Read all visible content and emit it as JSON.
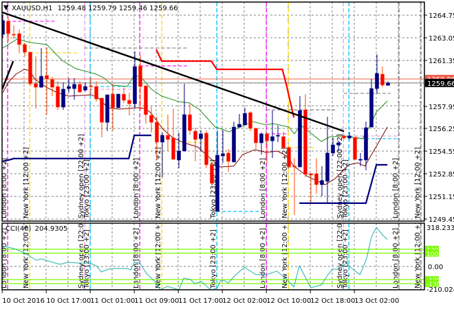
{
  "header": {
    "menu_icon": "triangle-down-icon",
    "symbol": "XAUUSD,H1",
    "ohlc": "1259.48 1259.79 1259.46 1259.66"
  },
  "cci_header": {
    "name": "CCI(40)",
    "value": "204.9305"
  },
  "colors": {
    "bull": "#000080",
    "bear": "#ff0000",
    "wick_bear": "#ff4500",
    "wick_bull": "#000080",
    "ma_fast": "#228b22",
    "ma_slow": "#800000",
    "trend": "#000000",
    "step_red": "#ff0000",
    "step_navy": "#000080",
    "cci": "#20b2aa",
    "cci_level": "#7cfc00",
    "grid": "#808080",
    "bid_line": "#f0604a",
    "last_line": "#808080"
  },
  "chart_data": {
    "type": "candlestick",
    "symbol": "XAUUSD",
    "timeframe": "H1",
    "ylim": [
      1249.45,
      1264.75
    ],
    "price_ticks": [
      "1264.75",
      "1263.05",
      "1261.35",
      "1257.95",
      "1256.25",
      "1254.55",
      "1252.85",
      "1251.15",
      "1249.45"
    ],
    "current_price": "1259.66",
    "bid_price": "1259.96",
    "time_ticks": [
      {
        "bar": -0.1,
        "label": "10 Oct 2016"
      },
      {
        "bar": 7.9,
        "label": "10 Oct 17:00"
      },
      {
        "bar": 15.9,
        "label": "11 Oct 01:00"
      },
      {
        "bar": 23.9,
        "label": "11 Oct 09:00"
      },
      {
        "bar": 31.9,
        "label": "11 Oct 17:00"
      },
      {
        "bar": 39.9,
        "label": "12 Oct 02:00"
      },
      {
        "bar": 47.9,
        "label": "12 Oct 10:00"
      },
      {
        "bar": 55.9,
        "label": "12 Oct 18:00"
      },
      {
        "bar": 63.9,
        "label": "13 Oct 02:00"
      }
    ],
    "candles_ohlc": [
      [
        1263.31,
        1264.75,
        1263.05,
        1264.34
      ],
      [
        1264.29,
        1264.6,
        1262.79,
        1263.36
      ],
      [
        1263.31,
        1263.98,
        1262.95,
        1263.3
      ],
      [
        1263.36,
        1263.67,
        1261.87,
        1262.54
      ],
      [
        1262.54,
        1262.69,
        1261.66,
        1261.97
      ],
      [
        1261.97,
        1261.97,
        1259.44,
        1259.6
      ],
      [
        1259.6,
        1261.66,
        1257.74,
        1259.34
      ],
      [
        1259.34,
        1262.28,
        1259.3,
        1260.16
      ],
      [
        1260.22,
        1262.33,
        1257.28,
        1259.96
      ],
      [
        1259.91,
        1260.11,
        1258.67,
        1259.34
      ],
      [
        1259.39,
        1259.8,
        1257.64,
        1257.85
      ],
      [
        1257.85,
        1259.7,
        1257.64,
        1259.19
      ],
      [
        1259.24,
        1260.01,
        1258.93,
        1259.39
      ],
      [
        1259.24,
        1260.01,
        1258.41,
        1259.55
      ],
      [
        1259.55,
        1259.8,
        1258.93,
        1258.98
      ],
      [
        1259.13,
        1259.7,
        1259.03,
        1259.39
      ],
      [
        1259.44,
        1260.06,
        1258.82,
        1259.42
      ],
      [
        1259.39,
        1259.8,
        1258.26,
        1258.46
      ],
      [
        1258.52,
        1258.52,
        1255.58,
        1256.71
      ],
      [
        1256.71,
        1258.77,
        1256.04,
        1258.77
      ],
      [
        1258.82,
        1259.6,
        1256.09,
        1257.8
      ],
      [
        1257.8,
        1258.85,
        1257.78,
        1258.82
      ],
      [
        1258.82,
        1259.29,
        1258.16,
        1258.36
      ],
      [
        1258.36,
        1258.93,
        1257.23,
        1258.1
      ],
      [
        1258.1,
        1262.02,
        1257.74,
        1260.89
      ],
      [
        1260.94,
        1261.76,
        1257.64,
        1259.39
      ],
      [
        1259.44,
        1259.44,
        1256.61,
        1257.28
      ],
      [
        1257.23,
        1257.9,
        1255.94,
        1256.71
      ],
      [
        1256.71,
        1257.12,
        1253.88,
        1255.22
      ],
      [
        1255.22,
        1255.94,
        1252.59,
        1255.73
      ],
      [
        1255.73,
        1257.28,
        1254.55,
        1255.42
      ],
      [
        1255.53,
        1257.74,
        1253.9,
        1253.93
      ],
      [
        1253.88,
        1255.94,
        1253.26,
        1254.55
      ],
      [
        1254.55,
        1259.6,
        1254.53,
        1257.28
      ],
      [
        1257.28,
        1258.05,
        1255.78,
        1256.09
      ],
      [
        1256.04,
        1256.3,
        1253.78,
        1255.42
      ],
      [
        1255.48,
        1256.09,
        1254.55,
        1255.84
      ],
      [
        1255.89,
        1256.09,
        1253.26,
        1253.52
      ],
      [
        1253.52,
        1253.78,
        1251.97,
        1252.13
      ],
      [
        1250.02,
        1256.09,
        1250.0,
        1254.24
      ],
      [
        1254.19,
        1256.09,
        1253.67,
        1254.35
      ],
      [
        1254.4,
        1254.7,
        1253.0,
        1253.78
      ],
      [
        1253.73,
        1256.76,
        1253.7,
        1256.35
      ],
      [
        1256.35,
        1257.33,
        1256.33,
        1256.56
      ],
      [
        1256.51,
        1257.8,
        1256.49,
        1257.38
      ],
      [
        1257.43,
        1257.54,
        1256.04,
        1256.25
      ],
      [
        1256.25,
        1256.3,
        1254.7,
        1255.17
      ],
      [
        1255.17,
        1255.94,
        1254.29,
        1255.84
      ],
      [
        1255.84,
        1255.94,
        1253.62,
        1255.32
      ],
      [
        1255.32,
        1257.59,
        1254.03,
        1255.63
      ],
      [
        1255.68,
        1256.46,
        1255.22,
        1255.73
      ],
      [
        1255.63,
        1255.99,
        1254.7,
        1254.81
      ],
      [
        1254.81,
        1254.91,
        1253.26,
        1253.36
      ],
      [
        1253.42,
        1254.03,
        1249.76,
        1253.36
      ],
      [
        1253.36,
        1258.67,
        1253.34,
        1257.59
      ],
      [
        1257.64,
        1258.82,
        1252.59,
        1252.8
      ],
      [
        1252.85,
        1252.9,
        1250.69,
        1252.75
      ],
      [
        1252.85,
        1254.03,
        1251.36,
        1252.03
      ],
      [
        1252.03,
        1253.42,
        1251.15,
        1252.34
      ],
      [
        1252.28,
        1257.12,
        1250.69,
        1254.4
      ],
      [
        1254.4,
        1255.58,
        1254.19,
        1255.01
      ],
      [
        1255.01,
        1255.32,
        1254.55,
        1255.17
      ],
      [
        1255.68,
        1255.78,
        1255.42,
        1255.53
      ],
      [
        1255.53,
        1255.99,
        1255.42,
        1255.68
      ],
      [
        1255.58,
        1255.6,
        1253.88,
        1253.93
      ],
      [
        1253.88,
        1254.4,
        1253.42,
        1253.93
      ],
      [
        1253.88,
        1256.76,
        1253.11,
        1256.3
      ],
      [
        1256.35,
        1259.96,
        1256.33,
        1259.24
      ],
      [
        1259.24,
        1261.81,
        1258.88,
        1260.37
      ],
      [
        1260.32,
        1260.89,
        1259.34,
        1259.5
      ],
      [
        1259.48,
        1259.79,
        1259.46,
        1259.66
      ]
    ],
    "ma_fast": [
      [
        0,
        1262.28
      ],
      [
        2.6,
        1262.95
      ],
      [
        5.1,
        1262.69
      ],
      [
        8,
        1262.54
      ],
      [
        10.8,
        1261.35
      ],
      [
        13.3,
        1260.73
      ],
      [
        17,
        1260.32
      ],
      [
        18.3,
        1260.06
      ],
      [
        19.9,
        1259.5
      ],
      [
        22.6,
        1259.39
      ],
      [
        23.9,
        1260.22
      ],
      [
        25.1,
        1260.11
      ],
      [
        27,
        1259.19
      ],
      [
        28.9,
        1258.67
      ],
      [
        32,
        1258.26
      ],
      [
        33.9,
        1258.16
      ],
      [
        35.8,
        1257.64
      ],
      [
        38.6,
        1256.35
      ],
      [
        39.5,
        1256.25
      ],
      [
        41.1,
        1255.99
      ],
      [
        45.4,
        1256.76
      ],
      [
        47.9,
        1256.51
      ],
      [
        49.1,
        1256.61
      ],
      [
        52,
        1256.35
      ],
      [
        53,
        1255.84
      ],
      [
        54.1,
        1256.51
      ],
      [
        57.9,
        1255.27
      ],
      [
        59.5,
        1255.63
      ],
      [
        62,
        1255.68
      ],
      [
        65.4,
        1255.48
      ],
      [
        66.6,
        1256.35
      ],
      [
        67.9,
        1257.48
      ],
      [
        69.9,
        1258.31
      ]
    ],
    "ma_slow": [
      [
        0,
        1258.93
      ],
      [
        1,
        1259.7
      ],
      [
        2.4,
        1260.32
      ],
      [
        3.9,
        1260.68
      ],
      [
        4.9,
        1260.58
      ],
      [
        5.8,
        1259.96
      ],
      [
        7.9,
        1259.34
      ],
      [
        9.9,
        1258.93
      ],
      [
        12,
        1258.67
      ],
      [
        16.1,
        1258.77
      ],
      [
        17.4,
        1258.52
      ],
      [
        19.1,
        1257.8
      ],
      [
        21.1,
        1257.69
      ],
      [
        24.5,
        1257.8
      ],
      [
        26,
        1257.74
      ],
      [
        27,
        1257.38
      ],
      [
        29.1,
        1256.2
      ],
      [
        30.8,
        1255.58
      ],
      [
        32.9,
        1255.17
      ],
      [
        35.4,
        1254.86
      ],
      [
        39.5,
        1253.36
      ],
      [
        42,
        1253.42
      ],
      [
        43.6,
        1254.29
      ],
      [
        45.8,
        1254.65
      ],
      [
        47.9,
        1254.45
      ],
      [
        49.9,
        1254.55
      ],
      [
        51.6,
        1254.19
      ],
      [
        52.9,
        1253.42
      ],
      [
        55.4,
        1252.64
      ],
      [
        58.6,
        1252.03
      ],
      [
        60.4,
        1252.49
      ],
      [
        62.9,
        1253.52
      ],
      [
        64.5,
        1253.67
      ],
      [
        65.8,
        1253.42
      ],
      [
        67.9,
        1254.91
      ],
      [
        69.9,
        1256.35
      ]
    ],
    "trendlines": [
      {
        "color": "trend",
        "points": [
          [
            -0.1,
            1264.96
          ],
          [
            62,
            1256.04
          ]
        ]
      },
      {
        "color": "trend",
        "points": [
          [
            -0.1,
            1259.19
          ],
          [
            1.9,
            1261.3
          ]
        ]
      }
    ],
    "step_red": [
      [
        27.9,
        1262.17
      ],
      [
        28.9,
        1261.3
      ],
      [
        37.9,
        1261.3
      ],
      [
        38.9,
        1260.68
      ],
      [
        50.8,
        1260.68
      ],
      [
        51.5,
        1259.6
      ],
      [
        52.9,
        1257.07
      ]
    ],
    "step_navy_1": [
      [
        -0.1,
        1253.78
      ],
      [
        1.1,
        1253.88
      ],
      [
        2,
        1253.99
      ],
      [
        22.9,
        1253.99
      ],
      [
        23.9,
        1255.73
      ],
      [
        27,
        1255.73
      ]
    ],
    "step_navy_2": [
      [
        53.9,
        1250.64
      ],
      [
        66,
        1250.64
      ],
      [
        67.9,
        1253.52
      ],
      [
        69.9,
        1253.52
      ]
    ],
    "levels": [
      {
        "price": 1264.29,
        "from": 0.8,
        "to": 9.5,
        "color": "#ff00ff"
      },
      {
        "price": 1261.92,
        "from": 4.9,
        "to": 13.5,
        "color": "#ffd700"
      },
      {
        "price": 1262.28,
        "from": 14.8,
        "to": 33.6,
        "color": "#808080"
      },
      {
        "price": 1260.94,
        "from": 24.9,
        "to": 33.5,
        "color": "#ff00ff"
      },
      {
        "price": 1259.39,
        "from": 15.8,
        "to": 23.6,
        "color": "#00bfff"
      },
      {
        "price": 1259.19,
        "from": 15.8,
        "to": 23.6,
        "color": "#dda0dd"
      },
      {
        "price": 1255.22,
        "from": 31.6,
        "to": 37.4,
        "color": "#ffd700"
      },
      {
        "price": 1255.84,
        "from": 47.9,
        "to": 51.6,
        "color": "#ff00ff"
      },
      {
        "price": 1254.81,
        "from": 52,
        "to": 56.6,
        "color": "#ffd700"
      },
      {
        "price": 1255.68,
        "from": 62,
        "to": 71.6,
        "color": "#dda0dd"
      },
      {
        "price": 1255.48,
        "from": 64,
        "to": 71.6,
        "color": "#00bfff"
      },
      {
        "price": 1250.02,
        "from": 38.9,
        "to": 46.6,
        "color": "#00bfff"
      },
      {
        "price": 1258.88,
        "from": 62,
        "to": 70.5,
        "color": "#808080"
      },
      {
        "price": 1257.64,
        "from": 47.9,
        "to": 60.4,
        "color": "#808080"
      }
    ],
    "sessions": [
      {
        "bar": 0.9,
        "label": "London  [8:00  +2]",
        "color": "#ff00ff"
      },
      {
        "bar": 4.9,
        "label": "New York  [12:00  +2]",
        "color": "#ffd700"
      },
      {
        "bar": 14.9,
        "label": "Sydney open  [22:00  +2]",
        "color": "#dda0dd"
      },
      {
        "bar": 15.9,
        "label": "Tokyo  [23:00  +2]",
        "color": "#00bfff"
      },
      {
        "bar": 24.9,
        "label": "London  [8:00  +2]",
        "color": "#ff00ff"
      },
      {
        "bar": 28.9,
        "label": "New York  [12:00  +2]",
        "color": "#ffd700"
      },
      {
        "bar": 38.9,
        "label": "Tokyo  [23:00  +2]",
        "color": "#00bfff"
      },
      {
        "bar": 47.9,
        "label": "London  [8:00  +2]",
        "color": "#ff00ff"
      },
      {
        "bar": 51.9,
        "label": "New York  [12:00  +2]",
        "color": "#ffd700"
      },
      {
        "bar": 61.9,
        "label": "Sydney open  [22:00  +2]",
        "color": "#dda0dd"
      },
      {
        "bar": 62.9,
        "label": "Tokyo  [23:00  +2]",
        "color": "#00bfff"
      },
      {
        "bar": 72,
        "label": "London  [8:00  +2]",
        "color": "#808080"
      },
      {
        "bar": 76,
        "label": "New York  [12:00  +2]",
        "color": "#808080"
      }
    ],
    "cci": {
      "period": 40,
      "max_label": "318.2339",
      "min_label": "-210.0242",
      "zero_label": "0.00",
      "levels": [
        {
          "value": 130,
          "label": "130"
        },
        {
          "value": 100,
          "label": "100"
        },
        {
          "value": -100,
          "label": "-100"
        },
        {
          "value": -130,
          "label": "-130"
        }
      ],
      "points": [
        [
          0,
          156
        ],
        [
          2,
          135
        ],
        [
          3.6,
          109
        ],
        [
          4.9,
          78
        ],
        [
          6.1,
          47
        ],
        [
          7,
          57
        ],
        [
          9.5,
          26
        ],
        [
          10.4,
          16
        ],
        [
          12,
          31
        ],
        [
          13.6,
          26
        ],
        [
          15.8,
          26
        ],
        [
          17,
          5
        ],
        [
          17.9,
          -42
        ],
        [
          19.1,
          -21
        ],
        [
          20.4,
          -16
        ],
        [
          22.6,
          -16
        ],
        [
          23.3,
          -26
        ],
        [
          23.9,
          31
        ],
        [
          24.9,
          26
        ],
        [
          26.1,
          -52
        ],
        [
          27.9,
          -125
        ],
        [
          28.6,
          -177
        ],
        [
          29.9,
          -151
        ],
        [
          32,
          -177
        ],
        [
          32.9,
          -88
        ],
        [
          34.1,
          -99
        ],
        [
          34.9,
          -130
        ],
        [
          36.1,
          -114
        ],
        [
          37.9,
          -182
        ],
        [
          39.1,
          -156
        ],
        [
          39.5,
          -109
        ],
        [
          40.1,
          -104
        ],
        [
          41,
          -125
        ],
        [
          42,
          -78
        ],
        [
          43.9,
          -5
        ],
        [
          46,
          -62
        ],
        [
          47.9,
          -62
        ],
        [
          49.8,
          -36
        ],
        [
          51.6,
          -99
        ],
        [
          52.9,
          -156
        ],
        [
          53.9,
          5
        ],
        [
          56,
          -161
        ],
        [
          57.9,
          -140
        ],
        [
          59.1,
          -62
        ],
        [
          59.9,
          -21
        ],
        [
          61.1,
          -21
        ],
        [
          62.4,
          26
        ],
        [
          63.6,
          -21
        ],
        [
          64.9,
          -62
        ],
        [
          66.1,
          57
        ],
        [
          67,
          224
        ],
        [
          67.9,
          296
        ],
        [
          69.1,
          234
        ],
        [
          69.9,
          205
        ]
      ]
    }
  }
}
